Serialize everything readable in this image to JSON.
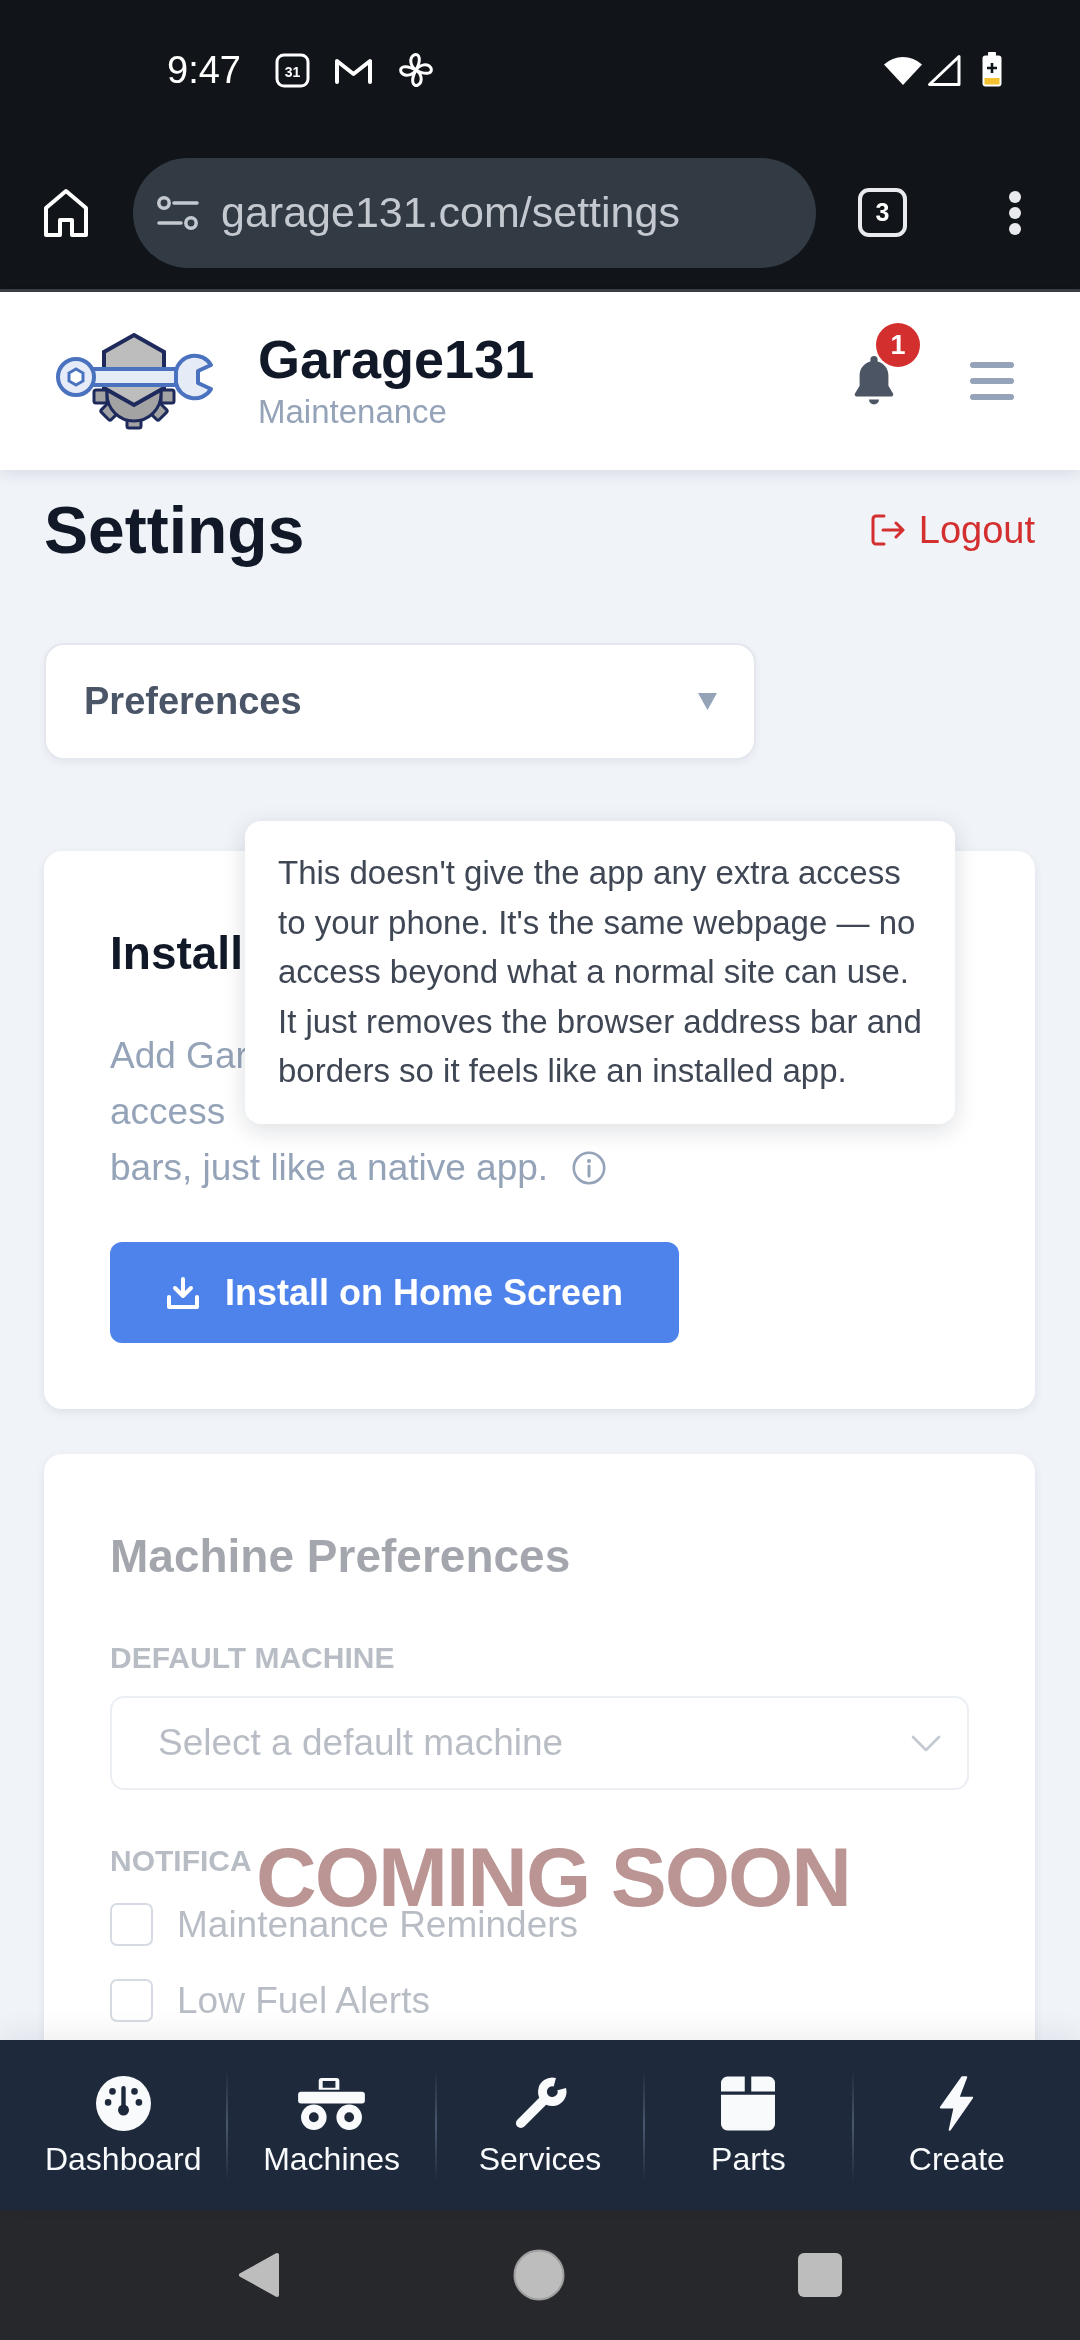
{
  "status_bar": {
    "time": "9:47",
    "calendar_day": "31"
  },
  "browser": {
    "url": "garage131.com/settings",
    "tab_count": "3"
  },
  "header": {
    "app_name": "Garage131",
    "subtitle": "Maintenance",
    "notification_count": "1"
  },
  "page": {
    "title": "Settings",
    "logout": "Logout"
  },
  "section_select": {
    "value": "Preferences"
  },
  "install_card": {
    "title": "Install",
    "description_lines": [
      "Add Gar",
      "access",
      "bars, just like a native app."
    ],
    "tooltip": "This doesn't give the app any extra access to your phone. It's the same webpage — no access beyond what a normal site can use. It just removes the browser address bar and borders so it feels like an installed app.",
    "button": "Install on Home Screen"
  },
  "machine_preferences": {
    "disabled": true,
    "title": "Machine Preferences",
    "default_machine": {
      "label": "DEFAULT MACHINE",
      "placeholder": "Select a default machine"
    },
    "notifications": {
      "label": "NOTIFICA",
      "options": [
        {
          "label": "Maintenance Reminders",
          "checked": false
        },
        {
          "label": "Low Fuel Alerts",
          "checked": false
        }
      ]
    },
    "overlay": "COMING SOON"
  },
  "bottom_nav": [
    {
      "label": "Dashboard",
      "selected": false
    },
    {
      "label": "Machines",
      "selected": false
    },
    {
      "label": "Services",
      "selected": false
    },
    {
      "label": "Parts",
      "selected": false
    },
    {
      "label": "Create",
      "selected": false
    }
  ]
}
